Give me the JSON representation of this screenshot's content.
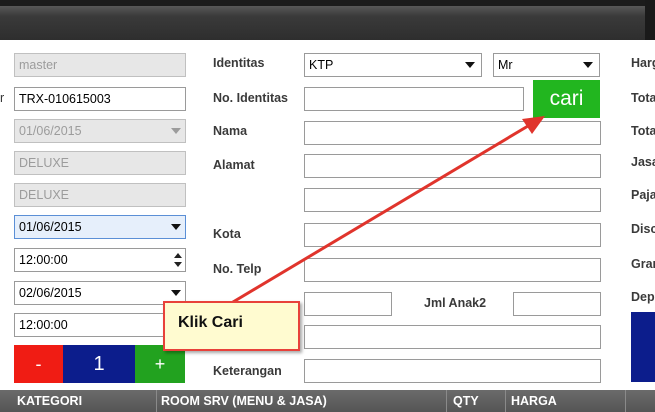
{
  "left_panel": {
    "user": "master",
    "transaction_no": "TRX-010615003",
    "date_disabled": "01/06/2015",
    "room_type": "DELUXE",
    "room_type2": "DELUXE",
    "checkin_date": "01/06/2015",
    "checkin_time": "12:00:00",
    "checkout_date": "02/06/2015",
    "checkout_time": "12:00:00",
    "minus_label": "-",
    "qty_value": "1",
    "plus_label": "+",
    "left_label_fragment": "r"
  },
  "form": {
    "identitas_label": "Identitas",
    "identitas_value": "KTP",
    "title_value": "Mr",
    "no_identitas_label": "No. Identitas",
    "no_identitas_value": "",
    "cari_label": "cari",
    "nama_label": "Nama",
    "alamat_label": "Alamat",
    "kota_label": "Kota",
    "no_telp_label": "No. Telp",
    "jml_anak_label": "Jml Anak2",
    "keterangan_label": "Keterangan"
  },
  "right_labels": [
    "Harg",
    "Tota",
    "Tota",
    "Jasa",
    "Paja",
    "Disc",
    "Gran",
    "Dep"
  ],
  "callout_text": "Klik Cari",
  "table_headers": {
    "kategori": "KATEGORI",
    "room_srv": "ROOM SRV (MENU & JASA)",
    "qty": "QTY",
    "harga": "HARGA"
  },
  "colors": {
    "cari_green": "#22b61f",
    "minus_red": "#f01c14",
    "qty_blue": "#0c1d8c",
    "plus_green": "#22a21f",
    "arrow_red": "#e0342c",
    "callout_bg": "#fffbd0"
  }
}
